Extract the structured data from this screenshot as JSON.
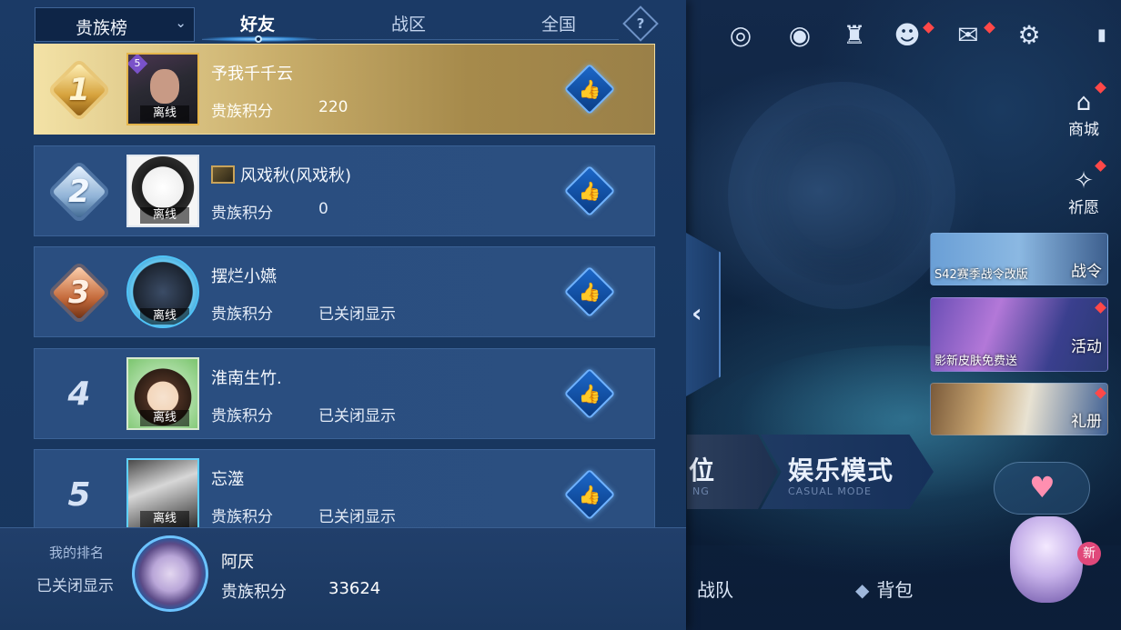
{
  "tabs": {
    "dropdown_label": "贵族榜",
    "friends": "好友",
    "zone": "战区",
    "national": "全国",
    "help": "?"
  },
  "rows": [
    {
      "rank": "1",
      "name": "予我千千云",
      "status": "离线",
      "score_label": "贵族积分",
      "score": "220",
      "level": "5"
    },
    {
      "rank": "2",
      "name": "风戏秋(风戏秋)",
      "status": "离线",
      "score_label": "贵族积分",
      "score": "0"
    },
    {
      "rank": "3",
      "name": "摆烂小嬿",
      "status": "离线",
      "score_label": "贵族积分",
      "score": "已关闭显示"
    },
    {
      "rank": "4",
      "name": "淮南生竹.",
      "status": "离线",
      "score_label": "贵族积分",
      "score": "已关闭显示"
    },
    {
      "rank": "5",
      "name": "忘澨",
      "status": "离线",
      "score_label": "贵族积分",
      "score": "已关闭显示"
    }
  ],
  "my_rank": {
    "label": "我的排名",
    "rank_text": "已关闭显示",
    "name": "阿厌",
    "score_label": "贵族积分",
    "score": "33624"
  },
  "lobby": {
    "shop": "商城",
    "wish": "祈愿",
    "battle_pass": "战令",
    "battle_pass_caption": "S42赛季战令改版",
    "activity": "活动",
    "activity_caption": "影新皮肤免费送",
    "gift": "礼册",
    "rank_mode": "位",
    "rank_mode_sub": "NG",
    "casual_mode": "娱乐模式",
    "casual_mode_sub": "CASUAL MODE",
    "team": "战队",
    "bag": "背包",
    "new_badge": "新"
  },
  "icons": {
    "like": "thumbs-up-icon",
    "settings": "gear-icon",
    "mail": "mail-icon",
    "friends": "friends-icon",
    "trophy": "trophy-icon",
    "eye": "eye-icon",
    "target": "target-icon"
  },
  "colors": {
    "panel": "#1b3a66",
    "first_row_gold": "#c8ad6a",
    "like_blue": "#1c67c8",
    "red_dot": "#ff4848"
  }
}
